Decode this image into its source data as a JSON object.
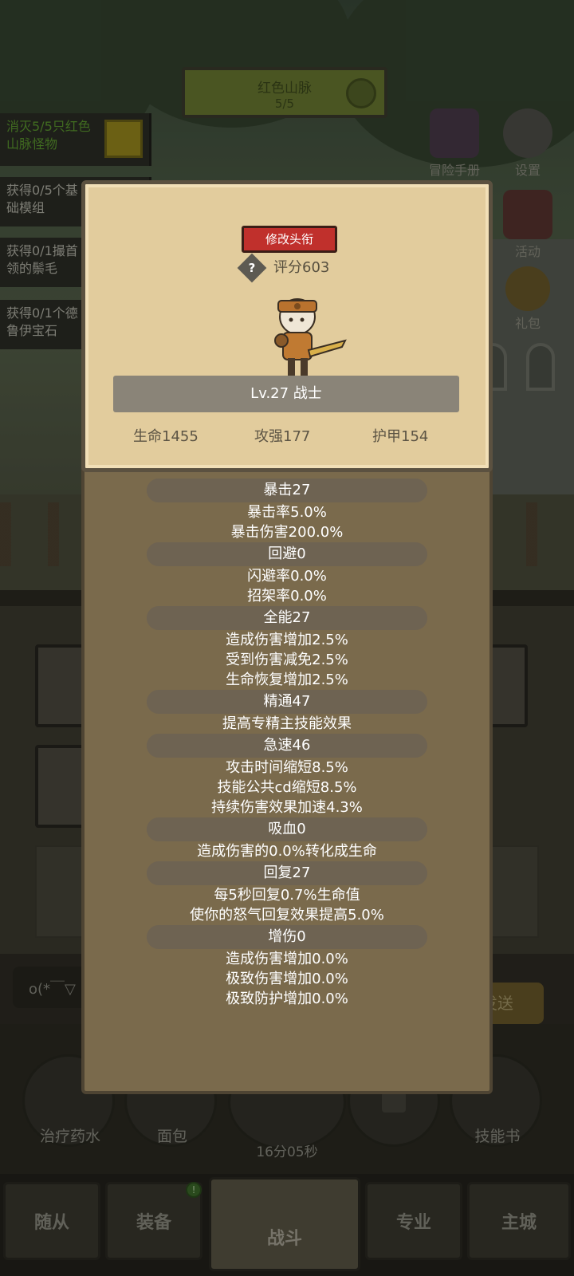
{
  "region": {
    "name": "红色山脉",
    "progress": "5/5"
  },
  "quests": [
    {
      "text": "消灭5/5只红色山脉怪物",
      "done": true
    },
    {
      "text": "获得0/5个基础模组",
      "done": false
    },
    {
      "text": "获得0/1撮首领的鬃毛",
      "done": false
    },
    {
      "text": "获得0/1个德鲁伊宝石",
      "done": false
    }
  ],
  "side_buttons": {
    "adventure_book": "冒险手册",
    "settings": "设置",
    "activity": "活动",
    "gift": "礼包"
  },
  "popup": {
    "rename_label": "修改头衔",
    "help_symbol": "?",
    "score_label": "评分603",
    "level_label": "Lv.27 战士",
    "hp_label": "生命1455",
    "attack_label": "攻强177",
    "armor_label": "护甲154",
    "categories": [
      {
        "title": "暴击27",
        "lines": [
          "暴击率5.0%",
          "暴击伤害200.0%"
        ]
      },
      {
        "title": "回避0",
        "lines": [
          "闪避率0.0%",
          "招架率0.0%"
        ]
      },
      {
        "title": "全能27",
        "lines": [
          "造成伤害增加2.5%",
          "受到伤害减免2.5%",
          "生命恢复增加2.5%"
        ]
      },
      {
        "title": "精通47",
        "lines": [
          "提高专精主技能效果"
        ]
      },
      {
        "title": "急速46",
        "lines": [
          "攻击时间缩短8.5%",
          "技能公共cd缩短8.5%",
          "持续伤害效果加速4.3%"
        ]
      },
      {
        "title": "吸血0",
        "lines": [
          "造成伤害的0.0%转化成生命"
        ]
      },
      {
        "title": "回复27",
        "lines": [
          "每5秒回复0.7%生命值",
          "使你的怒气回复效果提高5.0%"
        ]
      },
      {
        "title": "增伤0",
        "lines": [
          "造成伤害增加0.0%",
          "极致伤害增加0.0%",
          "极致防护增加0.0%"
        ]
      }
    ]
  },
  "chat": {
    "input_text": "o(*￣▽",
    "send_label": "发送"
  },
  "items": {
    "potion": "治疗药水",
    "bread": "面包",
    "skill_book": "技能书",
    "timer": "16分05秒"
  },
  "nav": {
    "followers": "随从",
    "equipment": "装备",
    "equipment_badge": "!",
    "battle": "战斗",
    "profession": "专业",
    "main_city": "主城"
  }
}
